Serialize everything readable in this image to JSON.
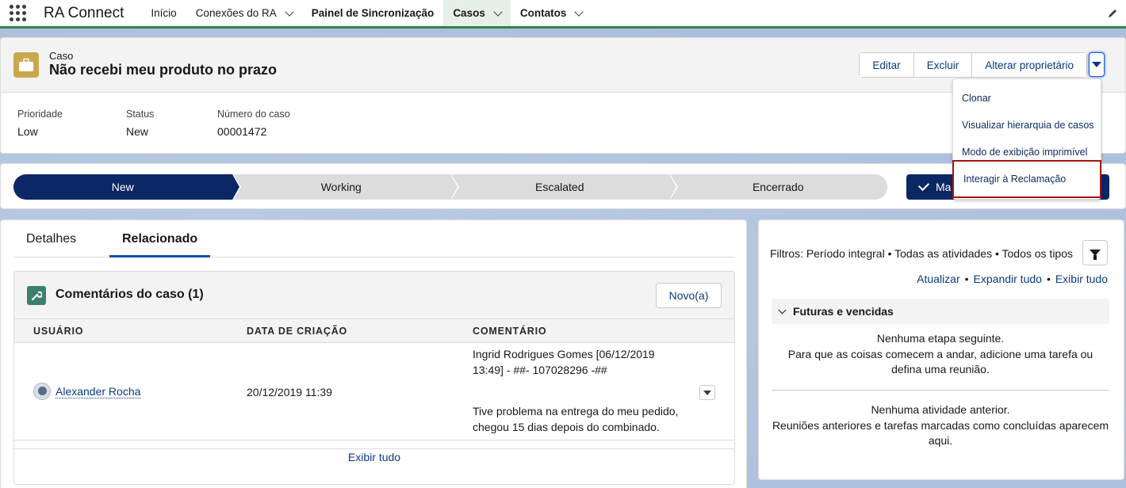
{
  "nav": {
    "app_name": "RA Connect",
    "items": [
      {
        "label": "Início"
      },
      {
        "label": "Conexões do RA"
      },
      {
        "label": "Painel de Sincronização"
      },
      {
        "label": "Casos"
      },
      {
        "label": "Contatos"
      }
    ]
  },
  "header": {
    "object_type": "Caso",
    "title": "Não recebi meu produto no prazo",
    "actions": {
      "edit": "Editar",
      "delete": "Excluir",
      "change_owner": "Alterar proprietário"
    },
    "fields": [
      {
        "label": "Prioridade",
        "value": "Low"
      },
      {
        "label": "Status",
        "value": "New"
      },
      {
        "label": "Número do caso",
        "value": "00001472"
      }
    ]
  },
  "dropdown": {
    "items": [
      "Clonar",
      "Visualizar hierarquia de casos",
      "Modo de exibição imprimível",
      "Interagir à Reclamação"
    ]
  },
  "path": {
    "steps": [
      "New",
      "Working",
      "Escalated",
      "Encerrado"
    ],
    "current": "New",
    "mark_button": "Ma"
  },
  "tabs": {
    "details": "Detalhes",
    "related": "Relacionado"
  },
  "case_comments": {
    "title": "Comentários do caso (1)",
    "new_button": "Novo(a)",
    "columns": [
      "USUÁRIO",
      "DATA DE CRIAÇÃO",
      "COMENTÁRIO"
    ],
    "rows": [
      {
        "user": "Alexander Rocha",
        "created": "20/12/2019 11:39",
        "comment_header": "Ingrid Rodrigues Gomes [06/12/2019\n13:49] - ##- 107028296 -##",
        "comment_body": "Tive problema na entrega do meu pedido,\nchegou 15 dias depois do combinado."
      }
    ],
    "view_all": "Exibir tudo"
  },
  "activity": {
    "filters": "Filtros: Período integral • Todas as atividades • Todos os tipos",
    "links": {
      "refresh": "Atualizar",
      "sep1": "•",
      "expand": "Expandir tudo",
      "sep2": "•",
      "view_all": "Exibir tudo"
    },
    "upcoming_title": "Futuras e vencidas",
    "upcoming_empty_title": "Nenhuma etapa seguinte.",
    "upcoming_empty_text": "Para que as coisas comecem a andar, adicione uma tarefa ou defina uma reunião.",
    "past_empty_title": "Nenhuma atividade anterior.",
    "past_empty_text": "Reuniões anteriores e tarefas marcadas como concluídas aparecem aqui."
  },
  "colors": {
    "brand_navy": "#0c2765",
    "nav_accent": "#2e844a",
    "case_icon": "#c9a84c",
    "highlight_border": "#a01515"
  }
}
